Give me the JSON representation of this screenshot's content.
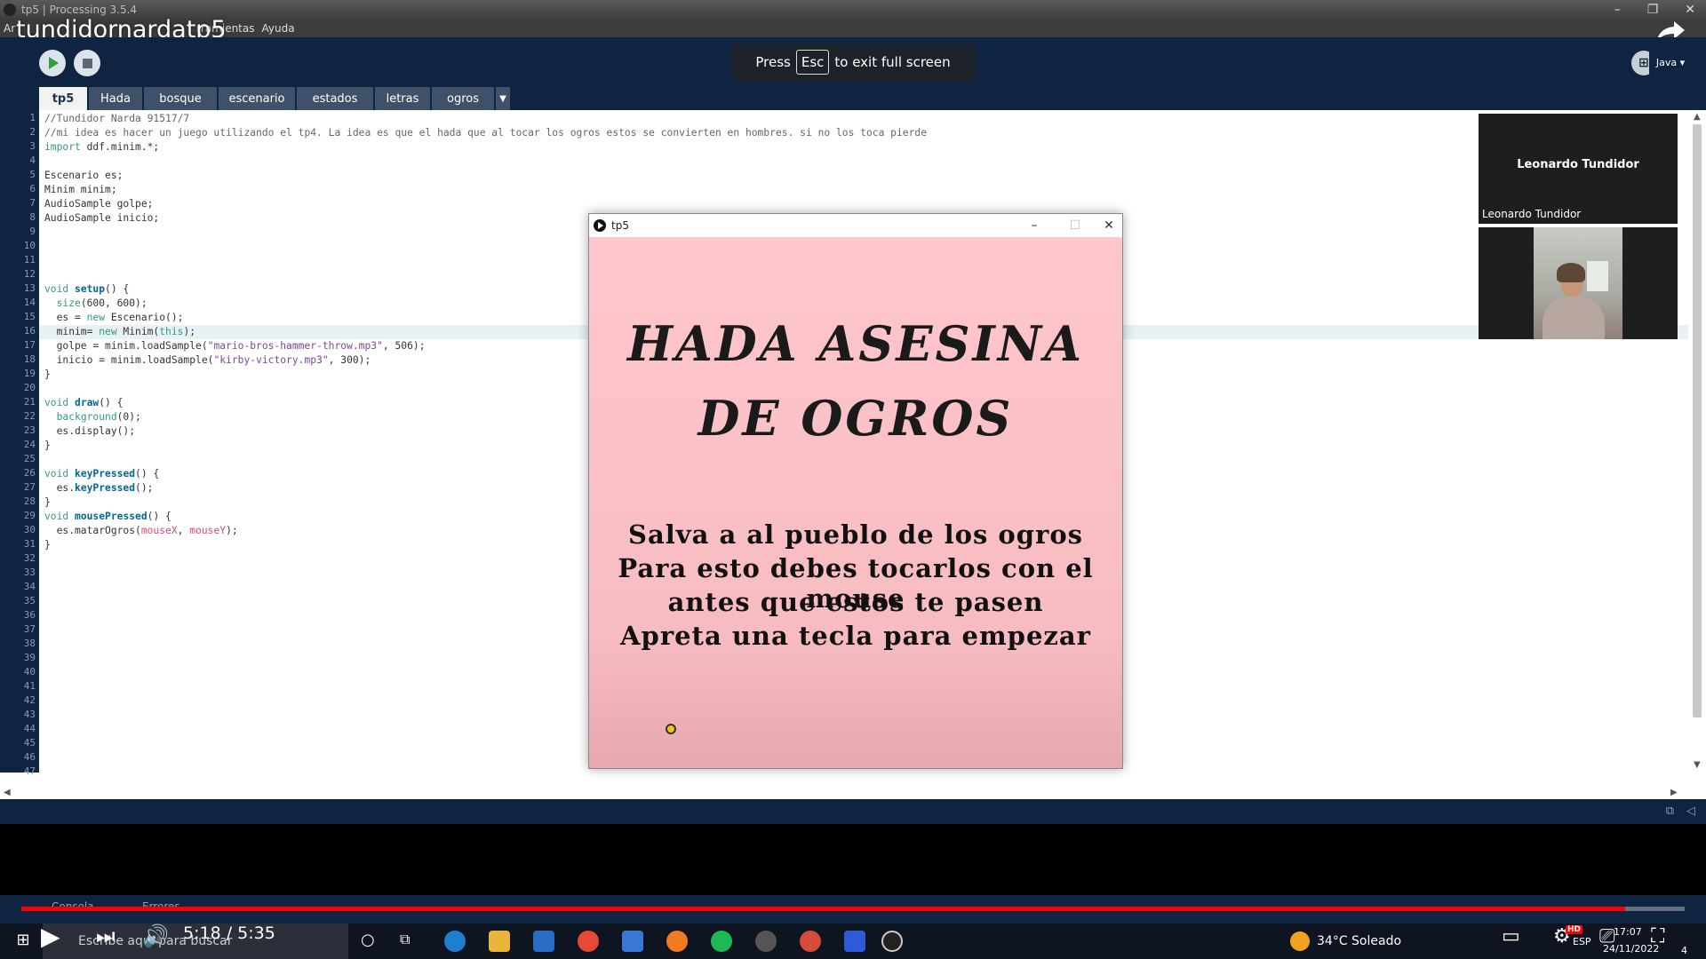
{
  "window": {
    "title": "tp5 | Processing 3.5.4",
    "menu_partial": "Ar",
    "menu_items": [
      "Herramientas",
      "Ayuda"
    ],
    "menu_visible": [
      "rramientas",
      "Ayuda"
    ]
  },
  "video": {
    "title": "tundidornardatp5",
    "current_time": "5:18",
    "duration": "5:35",
    "time_display": "5:18 / 5:35",
    "progress": 0.964
  },
  "fullscreen_toast": {
    "before": "Press",
    "key": "Esc",
    "after": "to exit full screen"
  },
  "toolbar": {
    "mode": "Java ▾"
  },
  "tabs": [
    "tp5",
    "Hada",
    "bosque",
    "escenario",
    "estados",
    "letras",
    "ogros"
  ],
  "active_tab": "tp5",
  "editor": {
    "line_count": 47,
    "highlighted_line": 16,
    "code": [
      "//Tundidor Narda 91517/7",
      "//mi idea es hacer un juego utilizando el tp4. La idea es que el hada que al tocar los ogros estos se convierten en hombres. si no los toca pierde",
      "import ddf.minim.*;",
      "",
      "Escenario es;",
      "Minim minim;",
      "AudioSample golpe;",
      "AudioSample inicio;",
      "",
      "",
      "",
      "",
      "void setup() {",
      "  size(600, 600);",
      "  es = new Escenario();",
      "  minim= new Minim(this);",
      "  golpe = minim.loadSample(\"mario-bros-hammer-throw.mp3\", 506);",
      "  inicio = minim.loadSample(\"kirby-victory.mp3\", 300);",
      "}",
      "",
      "void draw() {",
      "  background(0);",
      "  es.display();",
      "}",
      "",
      "void keyPressed() {",
      "  es.keyPressed();",
      "}",
      "void mousePressed() {",
      "  es.matarOgros(mouseX, mouseY);",
      "}"
    ]
  },
  "sketch_window": {
    "title": "tp5",
    "heading_lines": [
      "HADA ASESINA",
      "DE OGROS"
    ],
    "body_lines": [
      "Salva a al pueblo de los ogros",
      "Para esto debes tocarlos con el mouse",
      "antes que estos te pasen",
      "Apreta una tecla para empezar"
    ]
  },
  "participants": {
    "name_tile": "Leonardo Tundidor",
    "caption": "Leonardo Tundidor"
  },
  "console_tabs": [
    "Consola",
    "Errores"
  ],
  "taskbar": {
    "search_placeholder": "Escribe aquí para buscar",
    "weather": "34°C  Soleado",
    "language": "ESP",
    "clock": "17:07",
    "date": "24/11/2022",
    "notifications": "4"
  },
  "colors": {
    "toolbar_bg": "#0e2440",
    "tab_active": "#f2f2f2",
    "sketch_bg": "#ffc7cc",
    "progress": "#ff0000"
  }
}
